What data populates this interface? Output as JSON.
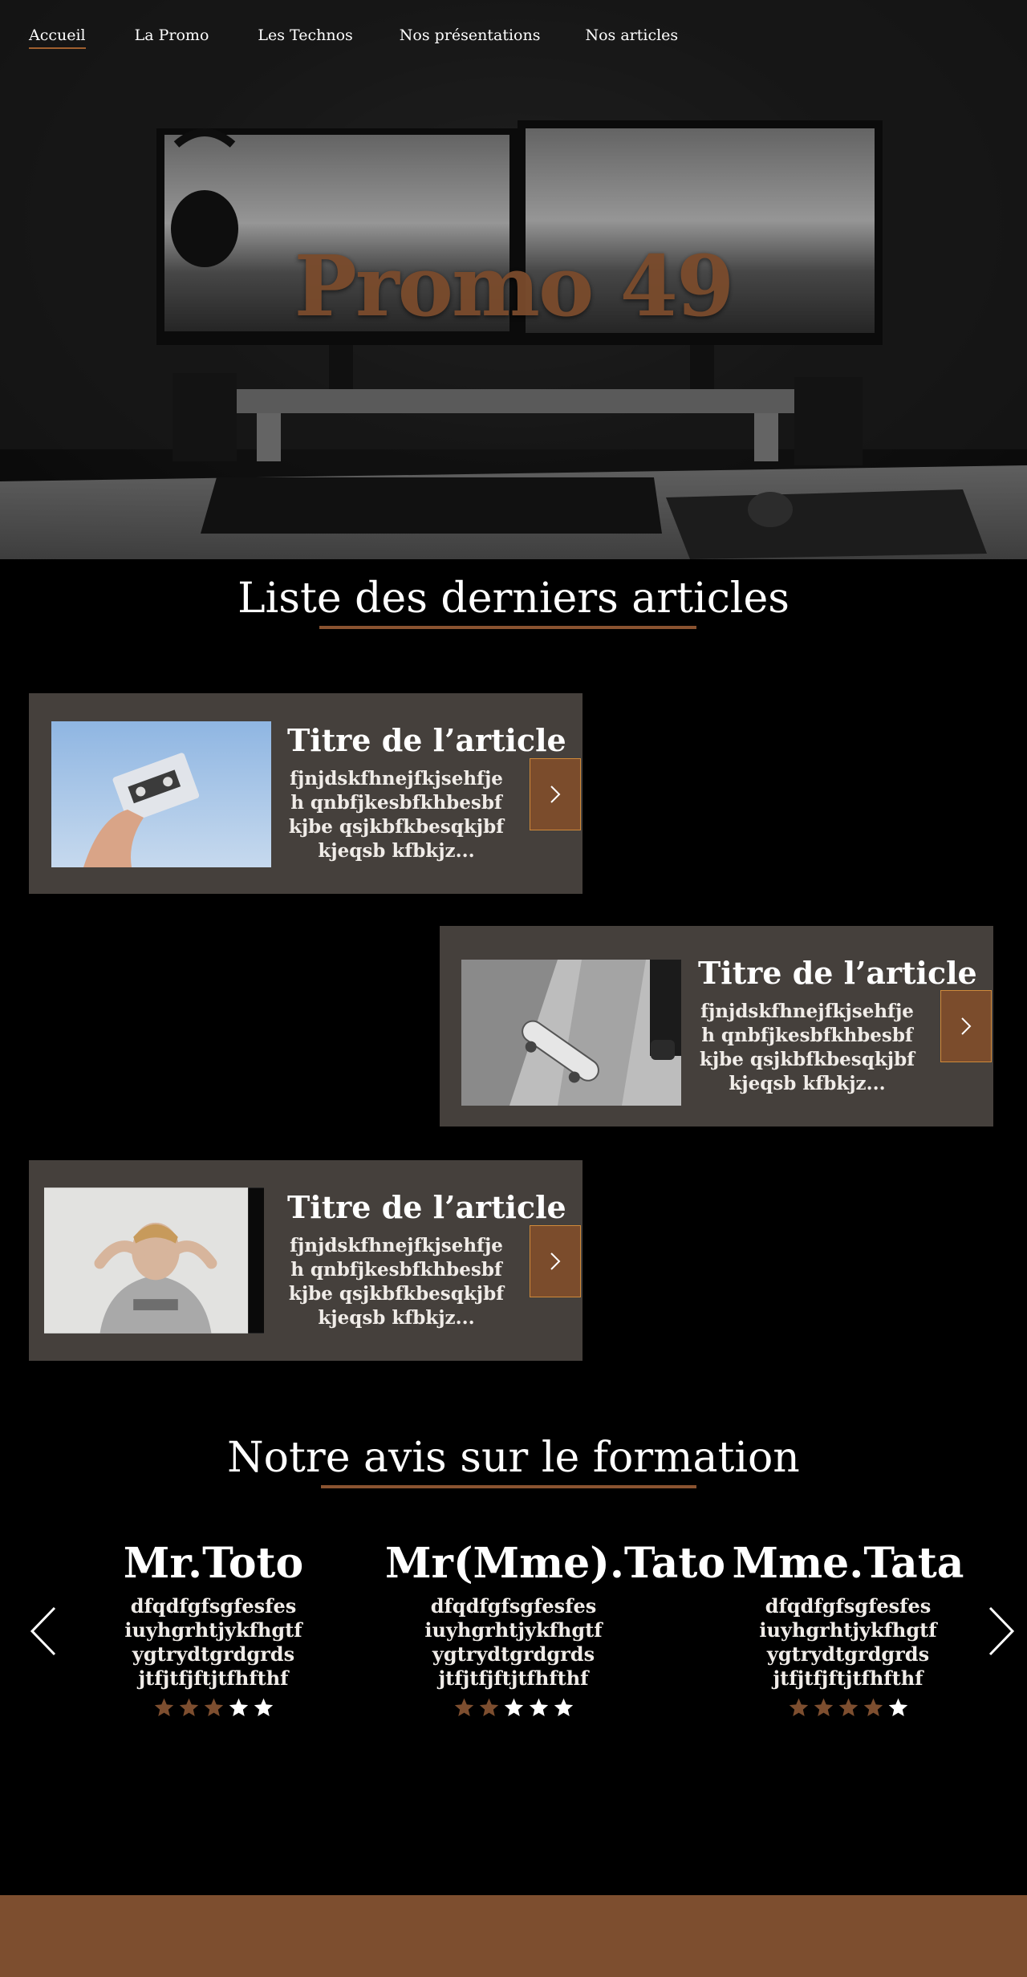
{
  "nav": {
    "items": [
      {
        "label": "Accueil",
        "active": true
      },
      {
        "label": "La Promo",
        "active": false
      },
      {
        "label": "Les Technos",
        "active": false
      },
      {
        "label": "Nos présentations",
        "active": false
      },
      {
        "label": "Nos articles",
        "active": false
      }
    ]
  },
  "hero": {
    "title": "Promo 49",
    "image": "desk-dual-monitor-photo"
  },
  "articles_section": {
    "title": "Liste des derniers articles",
    "articles": [
      {
        "title": "Titre de l’article",
        "excerpt": "fjnjdskfhnejfkjsehfjeh qnbfjkesbfkhbesbfkjbe qsjkbfkbesqkjbfkjeqsb kfbkjz...",
        "image": "cassette-photo"
      },
      {
        "title": "Titre de l’article",
        "excerpt": "fjnjdskfhnejfkjsehfjeh qnbfjkesbfkhbesbfkjbe qsjkbfkbesqkjbfkjeqsb kfbkjz...",
        "image": "skateboard-photo"
      },
      {
        "title": "Titre de l’article",
        "excerpt": "fjnjdskfhnejfkjsehfjeh qnbfjkesbfkhbesbfkjbe qsjkbfkbesqkjbfkjeqsb kfbkjz...",
        "image": "person-hoodie-photo"
      }
    ],
    "arrow_icon": "chevron-right-icon"
  },
  "reviews_section": {
    "title": "Notre avis sur le formation",
    "reviews": [
      {
        "name": "Mr.Toto",
        "lines": [
          "dfqdfgfsgfesfes",
          "iuyhgrhtjykfhgtf",
          "ygtrydtgrdgrds",
          "jtfjtfjftjtfhfthf"
        ],
        "rating": 3
      },
      {
        "name": "Mr(Mme).Tato",
        "lines": [
          "dfqdfgfsgfesfes",
          "iuyhgrhtjykfhgtf",
          "ygtrydtgrdgrds",
          "jtfjtfjftjtfhfthf"
        ],
        "rating": 2
      },
      {
        "name": "Mme.Tata",
        "lines": [
          "dfqdfgfsgfesfes",
          "iuyhgrhtjykfhgtf",
          "ygtrydtgrdgrds",
          "jtfjtfjftjtfhfthf"
        ],
        "rating": 4
      }
    ],
    "max_rating": 5,
    "prev_icon": "chevron-left-icon",
    "next_icon": "chevron-right-icon"
  },
  "colors": {
    "accent": "#8a5330",
    "card_bg": "#45403c",
    "star_filled": "#7d4e2f",
    "star_empty": "#ffffff",
    "footer": "#7d4e2f"
  }
}
